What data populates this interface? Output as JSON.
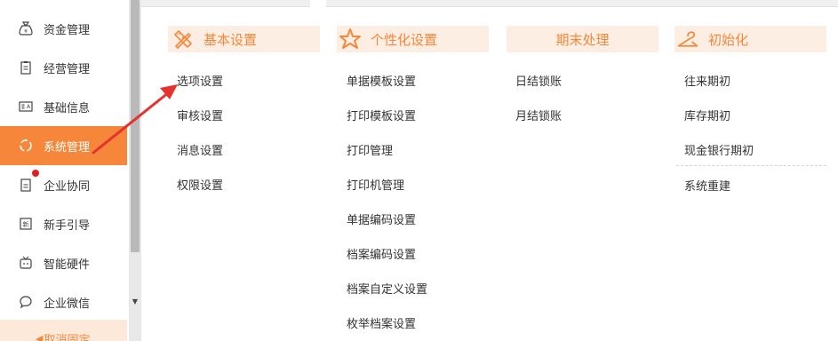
{
  "sidebar": {
    "items": [
      {
        "label": "资金管理",
        "icon": "money-bag-icon"
      },
      {
        "label": "经营管理",
        "icon": "clipboard-icon"
      },
      {
        "label": "基础信息",
        "icon": "id-card-icon"
      },
      {
        "label": "系统管理",
        "icon": "refresh-cycle-icon",
        "active": true
      },
      {
        "label": "企业协同",
        "icon": "document-icon",
        "badge": "red-dot"
      },
      {
        "label": "新手引导",
        "icon": "guide-icon"
      },
      {
        "label": "智能硬件",
        "icon": "tv-device-icon"
      },
      {
        "label": "企业微信",
        "icon": "chat-bubble-icon"
      }
    ],
    "unpin_label": "取消固定"
  },
  "colors": {
    "accent": "#f6873a",
    "header_bg": "#fdeee4",
    "badge_red": "#e02020"
  },
  "menu": {
    "columns": [
      {
        "title": "基本设置",
        "icon": "pencil-ruler-icon",
        "items": [
          "选项设置",
          "审核设置",
          "消息设置",
          "权限设置"
        ]
      },
      {
        "title": "个性化设置",
        "icon": "star-icon",
        "items": [
          "单据模板设置",
          "打印模板设置",
          "打印管理",
          "打印机管理",
          "单据编码设置",
          "档案编码设置",
          "档案自定义设置",
          "枚举档案设置"
        ]
      },
      {
        "title": "期末处理",
        "icon": "",
        "items": [
          "日结锁账",
          "月结锁账"
        ]
      },
      {
        "title": "初始化",
        "icon": "hanger-icon",
        "items": [
          "往来期初",
          "库存期初",
          "现金银行期初",
          "系统重建"
        ]
      }
    ]
  }
}
